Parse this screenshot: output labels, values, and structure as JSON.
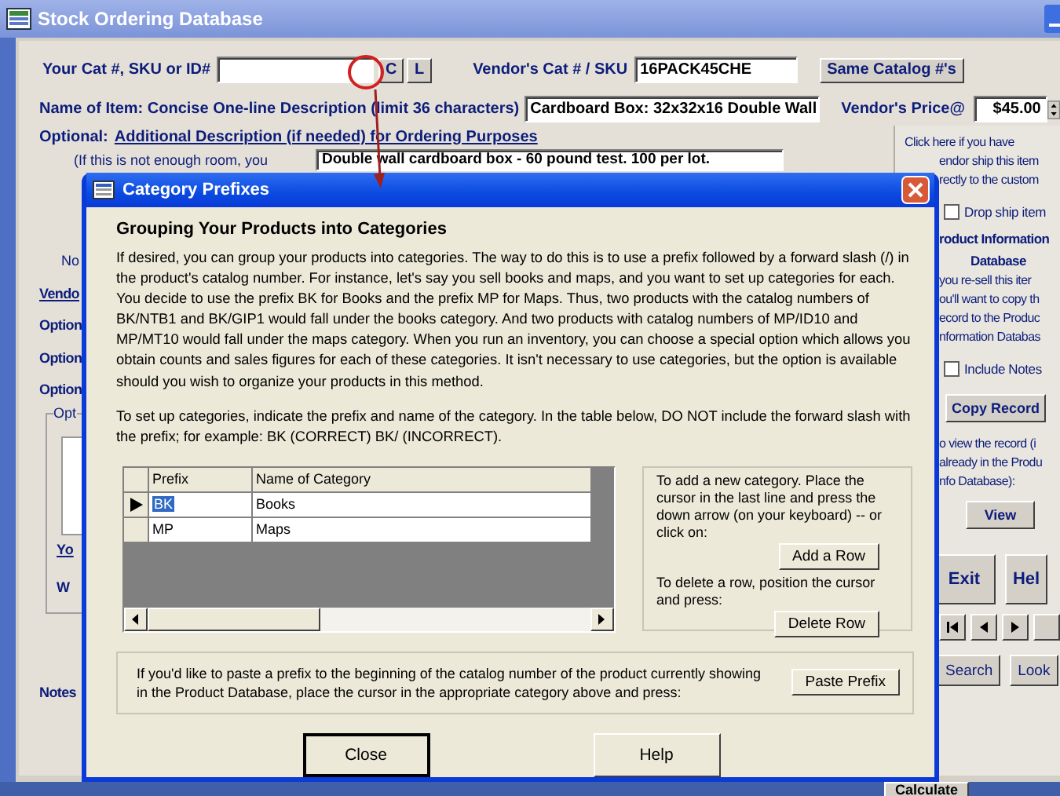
{
  "window": {
    "title": "Stock Ordering Database"
  },
  "form": {
    "cat_label": "Your Cat #, SKU or ID#",
    "cat_buttons": [
      "C",
      "L"
    ],
    "vendor_cat_label": "Vendor's Cat # / SKU",
    "vendor_cat_value": "16PACK45CHE",
    "same_button": "Same Catalog #'s",
    "name_label": "Name of Item: Concise One-line Description (limit 36 characters)",
    "name_value": "Cardboard Box: 32x32x16 Double Wall",
    "price_label": "Vendor's Price@",
    "price_value": "$45.00",
    "optional_label": "Optional:",
    "additional_label": "Additional Description (if needed) for Ordering Purposes",
    "room_note": "(If this is not enough room, you",
    "additional_value": "Double wall cardboard box - 60 pound test.  100 per lot."
  },
  "left_strip": [
    {
      "kind": "note",
      "text": "No"
    },
    {
      "kind": "link",
      "text": "Vendo"
    },
    {
      "kind": "label",
      "text": "Option"
    },
    {
      "kind": "label",
      "text": "Option"
    },
    {
      "kind": "label",
      "text": "Option"
    },
    {
      "kind": "group",
      "title": "Opt",
      "items": [
        "Yo",
        "W"
      ]
    },
    {
      "kind": "label",
      "text": "Notes"
    }
  ],
  "right_panel": [
    {
      "kind": "text",
      "text": "Click here if you have"
    },
    {
      "kind": "text",
      "text": "endor ship this item"
    },
    {
      "kind": "text",
      "text": "rectly to the custom"
    },
    {
      "kind": "checkbox",
      "label": "Drop ship item",
      "checked": false
    },
    {
      "kind": "heading",
      "text": "roduct Information"
    },
    {
      "kind": "heading",
      "text": "Database"
    },
    {
      "kind": "text",
      "text": "you re-sell this iter"
    },
    {
      "kind": "text",
      "text": "ou'll want to copy th"
    },
    {
      "kind": "text",
      "text": "ecord to the Produc"
    },
    {
      "kind": "text",
      "text": "nformation Databas"
    },
    {
      "kind": "checkbox",
      "label": "Include Notes",
      "checked": false
    },
    {
      "kind": "button",
      "label": "Copy Record"
    },
    {
      "kind": "text",
      "text": "o view the record (i"
    },
    {
      "kind": "text",
      "text": "already in the Produ"
    },
    {
      "kind": "text",
      "text": "nfo Database):"
    },
    {
      "kind": "button",
      "label": "View"
    },
    {
      "kind": "big_buttons",
      "labels": [
        "Exit",
        "Hel"
      ]
    },
    {
      "kind": "nav"
    },
    {
      "kind": "buttons",
      "labels": [
        "Search",
        "Look"
      ]
    }
  ],
  "bottom_bar": {
    "calculate_button": "Calculate"
  },
  "dialog": {
    "title": "Category Prefixes",
    "heading": "Grouping Your Products into Categories",
    "paragraphs": [
      "If desired, you can group your products into categories.  The way to do this is to use a prefix followed by a forward slash (/) in the product's catalog number.  For instance, let's say you sell books and maps, and you want to set up categories for each.  You decide to use the prefix BK for Books and the prefix MP for Maps.  Thus, two products with the catalog numbers of BK/NTB1 and BK/GIP1 would fall under the books category.  And two products with catalog numbers of MP/ID10 and MP/MT10 would fall under the maps category.  When you run an inventory, you can choose a special option which allows you obtain counts and sales figures for each of these categories.  It isn't necessary to use categories, but the option is available should you wish to organize your products in this method.",
      "To set up categories, indicate the prefix and name of the category.  In the table below, DO NOT include the forward slash with the prefix; for example:  BK (CORRECT)  BK/ (INCORRECT)."
    ],
    "table": {
      "columns": [
        "Prefix",
        "Name of Category"
      ],
      "rows": [
        {
          "prefix": "BK",
          "name": "Books",
          "selected": true
        },
        {
          "prefix": "MP",
          "name": "Maps",
          "selected": false
        }
      ]
    },
    "add_text": "To add a new category.  Place the cursor in the last line and press the down arrow (on your keyboard) -- or click on:",
    "add_button": "Add a Row",
    "delete_text": "To delete a row, position the cursor and press:",
    "delete_button": "Delete Row",
    "paste_text": "If you'd like to paste a prefix to the beginning of the catalog number of the product currently showing in the Product Database, place the cursor in the appropriate category above and press:",
    "paste_button": "Paste Prefix",
    "buttons": [
      "Close",
      "Help"
    ]
  }
}
